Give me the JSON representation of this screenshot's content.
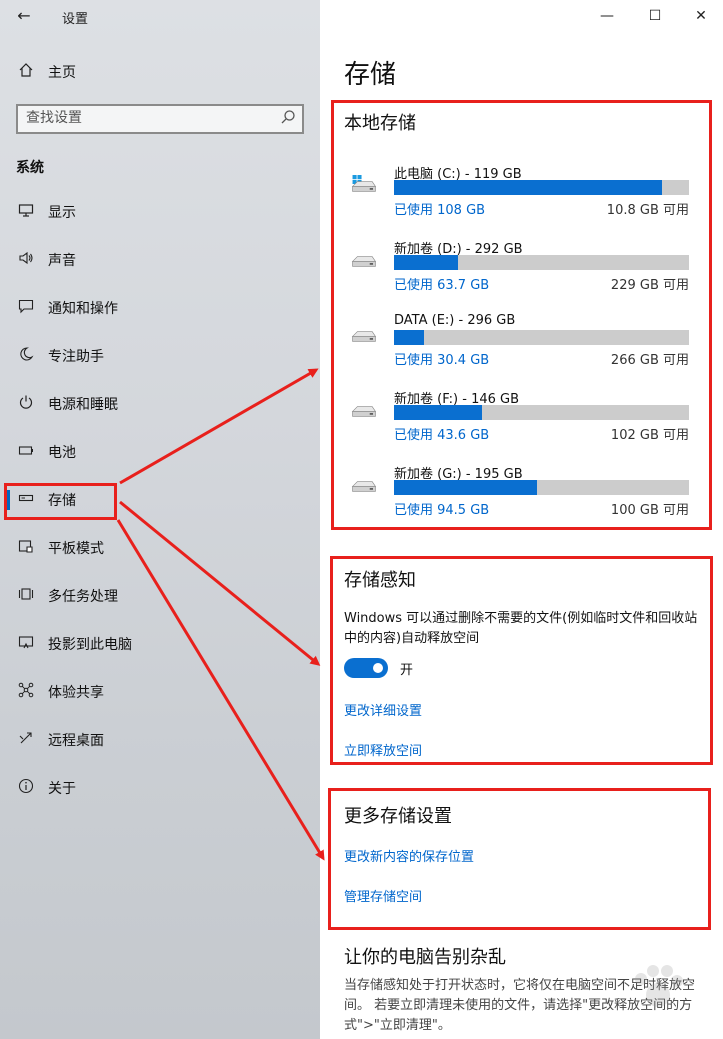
{
  "window": {
    "title": "设置",
    "back_icon": "arrow-left-icon",
    "controls": {
      "minimize": "—",
      "maximize": "☐",
      "close": "✕"
    }
  },
  "sidebar": {
    "home_label": "主页",
    "search_placeholder": "查找设置",
    "section_title": "系统",
    "items": [
      {
        "label": "显示",
        "icon": "monitor-icon"
      },
      {
        "label": "声音",
        "icon": "speaker-icon"
      },
      {
        "label": "通知和操作",
        "icon": "notification-icon"
      },
      {
        "label": "专注助手",
        "icon": "moon-icon"
      },
      {
        "label": "电源和睡眠",
        "icon": "power-icon"
      },
      {
        "label": "电池",
        "icon": "battery-icon"
      },
      {
        "label": "存储",
        "icon": "storage-icon",
        "active": true
      },
      {
        "label": "平板模式",
        "icon": "tablet-icon"
      },
      {
        "label": "多任务处理",
        "icon": "multitask-icon"
      },
      {
        "label": "投影到此电脑",
        "icon": "project-icon"
      },
      {
        "label": "体验共享",
        "icon": "share-icon"
      },
      {
        "label": "远程桌面",
        "icon": "remote-desktop-icon"
      },
      {
        "label": "关于",
        "icon": "info-icon"
      }
    ]
  },
  "main": {
    "page_title": "存储",
    "local_storage": {
      "title": "本地存储",
      "drives": [
        {
          "name": "此电脑 (C:) - 119 GB",
          "used": "已使用 108 GB",
          "free": "10.8 GB 可用",
          "fraction": 0.908,
          "system": true
        },
        {
          "name": "新加卷 (D:) - 292 GB",
          "used": "已使用 63.7 GB",
          "free": "229 GB 可用",
          "fraction": 0.218
        },
        {
          "name": "DATA (E:) - 296 GB",
          "used": "已使用 30.4 GB",
          "free": "266 GB 可用",
          "fraction": 0.103
        },
        {
          "name": "新加卷 (F:) - 146 GB",
          "used": "已使用 43.6 GB",
          "free": "102 GB 可用",
          "fraction": 0.299
        },
        {
          "name": "新加卷 (G:) - 195 GB",
          "used": "已使用 94.5 GB",
          "free": "100 GB 可用",
          "fraction": 0.485
        }
      ]
    },
    "storage_sense": {
      "title": "存储感知",
      "description": "Windows 可以通过删除不需要的文件(例如临时文件和回收站中的内容)自动释放空间",
      "toggle_label": "开",
      "toggle_on": true,
      "link_settings": "更改详细设置",
      "link_free_now": "立即释放空间"
    },
    "more_settings": {
      "title": "更多存储设置",
      "link_save_location": "更改新内容的保存位置",
      "link_manage_spaces": "管理存储空间"
    },
    "declutter": {
      "title": "让你的电脑告别杂乱",
      "description": "当存储感知处于打开状态时，它将仅在电脑空间不足时释放空间。 若要立即清理未使用的文件，请选择\"更改释放空间的方式\">\"立即清理\"。"
    }
  },
  "colors": {
    "accent": "#0a6fd0",
    "annotation": "#e8201c",
    "bar_track": "#cccccc"
  }
}
